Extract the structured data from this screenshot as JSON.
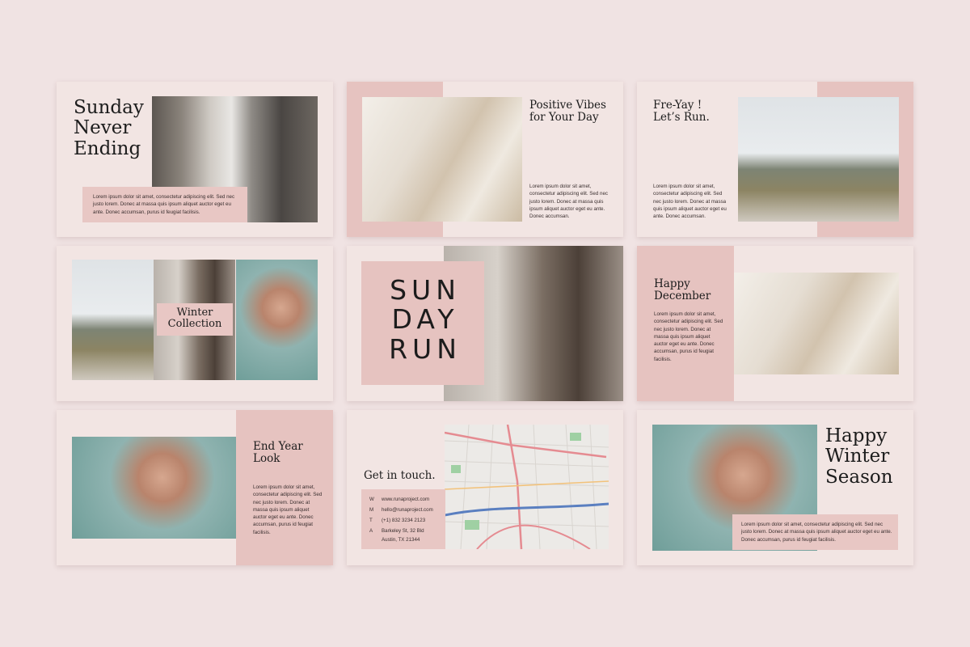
{
  "slides": {
    "s1": {
      "title": "Sunday\nNever\nEnding",
      "body": "Lorem ipsum dolor sit amet, consectetur adipiscing elit. Sed nec justo lorem. Donec at massa quis ipsum aliquet auctor eget eu ante. Donec accumsan, purus id feugiat facilisis."
    },
    "s2": {
      "title": "Positive Vibes\nfor Your Day",
      "body": "Lorem ipsum dolor sit amet, consectetur adipiscing elit. Sed nec justo lorem. Donec at massa quis ipsum aliquet auctor eget eu ante. Donec accumsan."
    },
    "s3": {
      "title": "Fre-Yay !\nLet’s Run.",
      "body": "Lorem ipsum dolor sit amet, consectetur adipiscing elit. Sed nec justo lorem. Donec at massa quis ipsum aliquet auctor eget eu ante. Donec accumsan."
    },
    "s4": {
      "title": "Winter\nCollection"
    },
    "s5": {
      "title": "SUN\nDAY\nRUN"
    },
    "s6": {
      "title": "Happy\nDecember",
      "body": "Lorem ipsum dolor sit amet, consectetur adipiscing elit. Sed nec justo lorem. Donec at massa quis ipsum aliquet auctor eget eu ante. Donec accumsan, purus id feugiat facilisis."
    },
    "s7": {
      "title": "End Year\nLook",
      "body": "Lorem ipsum dolor sit amet, consectetur adipiscing elit. Sed nec justo lorem. Donec at massa quis ipsum aliquet auctor eget eu ante. Donec accumsan, purus id feugiat facilisis."
    },
    "s8": {
      "title": "Get in touch.",
      "contacts": [
        {
          "key": "W",
          "value": "www.runaproject.com"
        },
        {
          "key": "M",
          "value": "hello@runaproject.com"
        },
        {
          "key": "T",
          "value": "(+1) 832 3234 2123"
        },
        {
          "key": "A",
          "value": "Barkeley St, 32 Bld"
        }
      ],
      "address_line2": "Austin, TX 21344"
    },
    "s9": {
      "title": "Happy\nWinter\nSeason",
      "body": "Lorem ipsum dolor sit amet, consectetur adipiscing elit. Sed nec justo lorem. Donec at massa quis ipsum aliquet auctor eget eu ante. Donec accumsan, purus id feugiat facilisis."
    }
  },
  "colors": {
    "background": "#f0e3e3",
    "slide": "#f2e5e3",
    "accent_pink": "#e6c3c0",
    "text": "#1c1c1c"
  }
}
